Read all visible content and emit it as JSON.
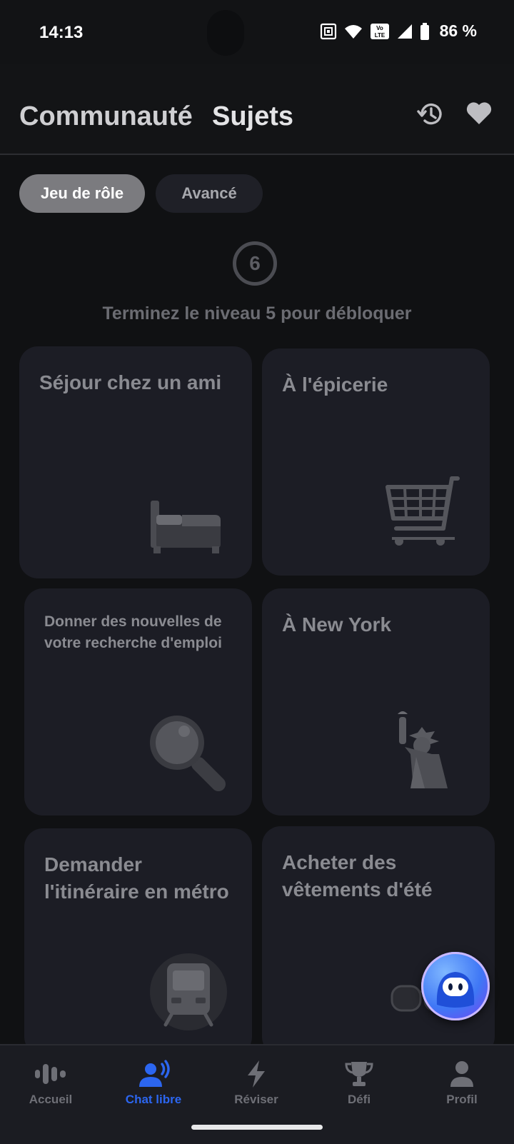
{
  "status_bar": {
    "time": "14:13",
    "battery": "86 %",
    "volte": "Vo LTE"
  },
  "header": {
    "tabs": [
      "Communauté",
      "Sujets"
    ],
    "icons": [
      "history-icon",
      "heart-icon"
    ]
  },
  "segments": {
    "active": "Jeu de rôle",
    "inactive": "Avancé"
  },
  "lock": {
    "level": "6",
    "message": "Terminez le niveau 5 pour débloquer"
  },
  "cards": [
    {
      "title": "Séjour chez un ami",
      "icon": "bed-icon"
    },
    {
      "title": "À l'épicerie",
      "icon": "shopping-cart-icon"
    },
    {
      "title": "Donner des nouvelles de votre recherche d'emploi",
      "icon": "magnifier-icon"
    },
    {
      "title": "À New York",
      "icon": "statue-of-liberty-icon"
    },
    {
      "title": "Demander l'itinéraire en métro",
      "icon": "metro-train-icon"
    },
    {
      "title": "Acheter des vêtements d'été",
      "icon": "sunglasses-icon"
    }
  ],
  "bottom_nav": [
    {
      "label": "Accueil",
      "icon": "waveform-icon"
    },
    {
      "label": "Chat libre",
      "icon": "chat-voice-icon",
      "active": true
    },
    {
      "label": "Réviser",
      "icon": "lightning-icon"
    },
    {
      "label": "Défi",
      "icon": "trophy-icon"
    },
    {
      "label": "Profil",
      "icon": "person-icon"
    }
  ],
  "colors": {
    "background": "#101113",
    "card": "#1c1d25",
    "accent": "#2c66f0"
  }
}
